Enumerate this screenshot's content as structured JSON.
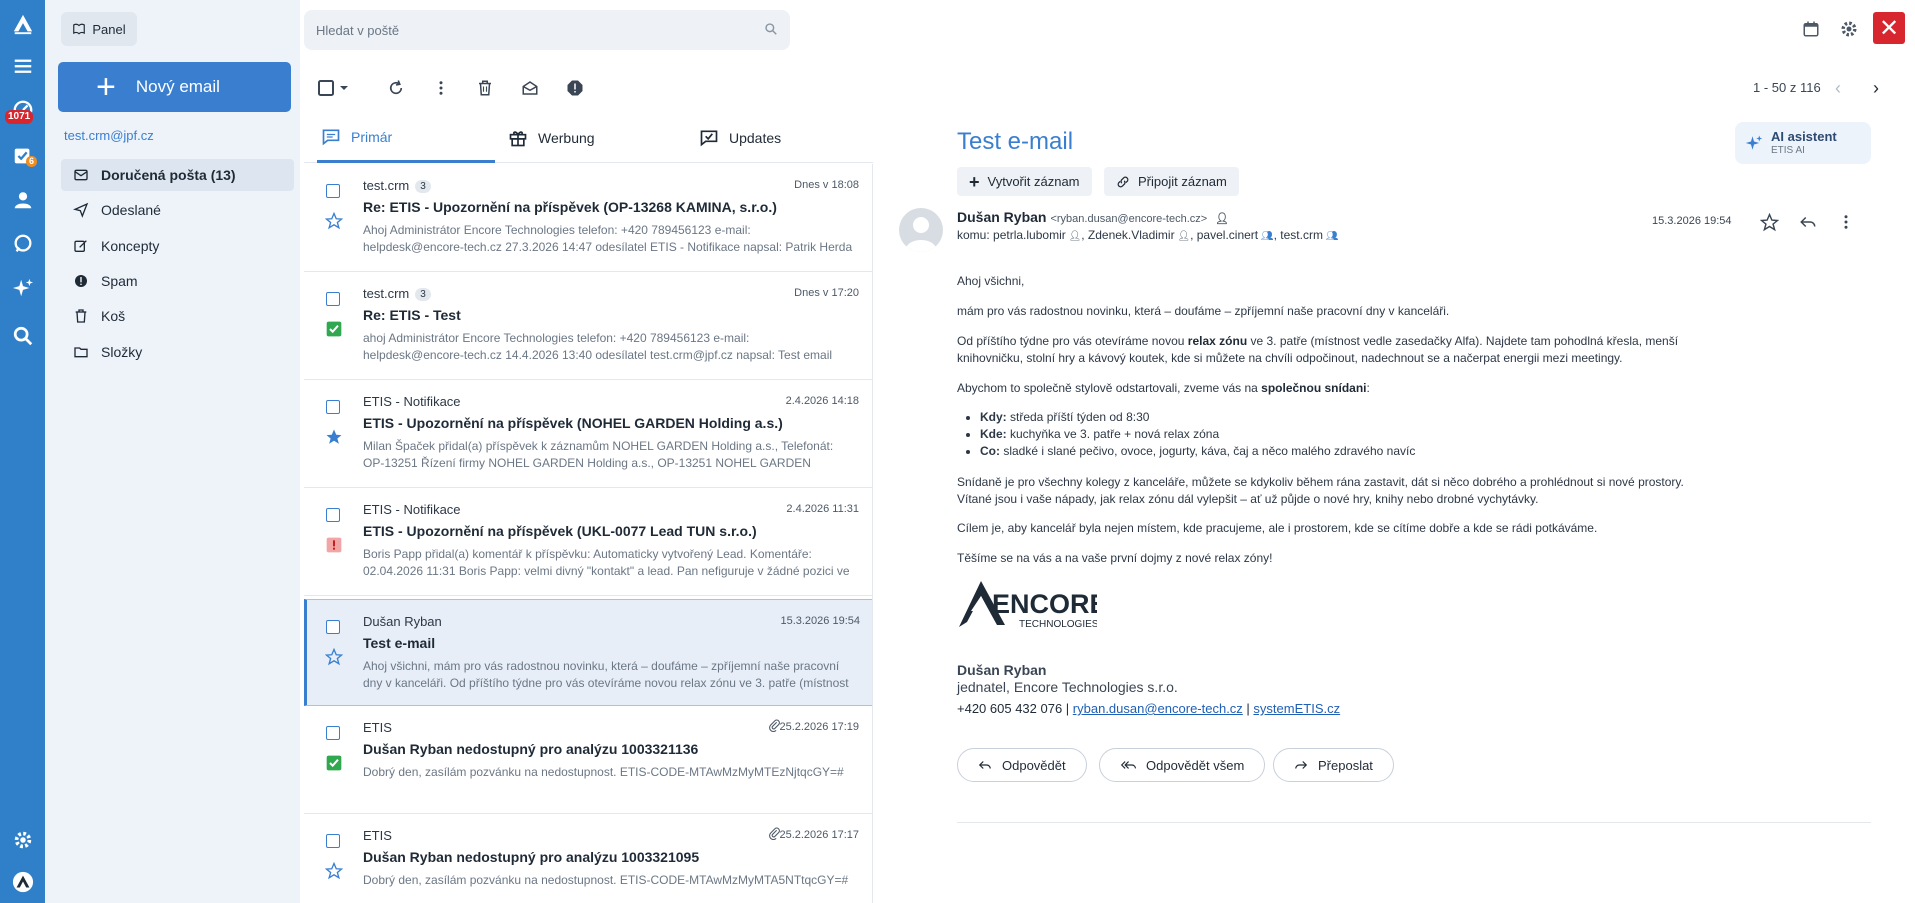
{
  "rail": {
    "badge_count": "1071",
    "task_badge": "6"
  },
  "sidebar": {
    "panel_label": "Panel",
    "new_email_label": "Nový email",
    "account": "test.crm@jpf.cz",
    "folders": [
      {
        "label": "Doručená pošta (13)",
        "icon": "inbox-icon"
      },
      {
        "label": "Odeslané",
        "icon": "send-icon"
      },
      {
        "label": "Koncepty",
        "icon": "draft-icon"
      },
      {
        "label": "Spam",
        "icon": "spam-icon"
      },
      {
        "label": "Koš",
        "icon": "trash-icon"
      },
      {
        "label": "Složky",
        "icon": "folder-icon"
      }
    ]
  },
  "search": {
    "placeholder": "Hledat v poště"
  },
  "toolbar": {
    "pager": "1 - 50 z 116"
  },
  "tabs": [
    {
      "label": "Primár"
    },
    {
      "label": "Werbung"
    },
    {
      "label": "Updates"
    }
  ],
  "messages": [
    {
      "from": "test.crm",
      "count": "3",
      "date": "Dnes v 18:08",
      "subject": "Re: ETIS - Upozornění na příspěvek (OP-13268 KAMINA, s.r.o.)",
      "preview": "Ahoj Administrátor Encore Technologies telefon: +420 789456123 e-mail: helpdesk@encore-tech.cz 27.3.2026 14:47 odesílatel ETIS - Notifikace napsal: Patrik Herda přidal(a) komentář k..."
    },
    {
      "from": "test.crm",
      "count": "3",
      "date": "Dnes v 17:20",
      "subject": "Re: ETIS - Test",
      "preview": "ahoj Administrátor Encore Technologies telefon: +420 789456123 e-mail: helpdesk@encore-tech.cz 14.4.2026 13:40 odesílatel test.crm@jpf.cz napsal: Test email"
    },
    {
      "from": "ETIS - Notifikace",
      "date": "2.4.2026 14:18",
      "subject": "ETIS - Upozornění na příspěvek (NOHEL GARDEN Holding a.s.)",
      "preview": "Milan Špaček přidal(a) příspěvek k záznamům NOHEL GARDEN Holding a.s., Telefonát: OP-13251 Řízení firmy NOHEL GARDEN Holding a.s., OP-13251 NOHEL GARDEN Holding a.s.: Nebere..."
    },
    {
      "from": "ETIS - Notifikace",
      "date": "2.4.2026 11:31",
      "subject": "ETIS - Upozornění na příspěvek (UKL-0077 Lead TUN s.r.o.)",
      "preview": "Boris Papp přidal(a) komentář k příspěvku: Automaticky vytvořený Lead. Komentáře: 02.04.2026 11:31 Boris Papp: velmi divný \"kontakt\" a lead. Pan nefiguruje v žádné pozici ve firmě, jen jako..."
    },
    {
      "from": "Dušan Ryban",
      "date": "15.3.2026 19:54",
      "subject": "Test e-mail",
      "preview": "Ahoj všichni, mám pro vás radostnou novinku, která – doufáme – zpříjemní naše pracovní dny v kanceláři. Od příštího týdne pro vás otevíráme novou relax zónu ve 3. patře (místnost vedle..."
    },
    {
      "from": "ETIS",
      "date": "25.2.2026 17:19",
      "subject": "Dušan Ryban nedostupný pro analýzu 1003321136",
      "preview": "Dobrý den, zasílám pozvánku na nedostupnost. ETIS-CODE-MTAwMzMyMTEzNjtqcGY=#"
    },
    {
      "from": "ETIS",
      "date": "25.2.2026 17:17",
      "subject": "Dušan Ryban nedostupný pro analýzu 1003321095",
      "preview": "Dobrý den, zasílám pozvánku na nedostupnost. ETIS-CODE-MTAwMzMyMTA5NTtqcGY=#"
    }
  ],
  "pane": {
    "title": "Test e-mail",
    "ai_label": "AI asistent",
    "ai_sub": "ETIS AI",
    "create_record": "Vytvořit záznam",
    "attach_record": "Připojit záznam",
    "sender_name": "Dušan Ryban",
    "sender_addr": "<ryban.dusan@encore-tech.cz>",
    "to_label": "komu:",
    "recipients": [
      "petrla.lubomir",
      "Zdenek.Vladimir",
      "pavel.cinert",
      "test.crm"
    ],
    "date": "15.3.2026 19:54",
    "greeting": "Ahoj všichni,",
    "p1": "mám pro vás radostnou novinku, která – doufáme – zpříjemní naše pracovní dny v kanceláři.",
    "p2a": "Od příštího týdne pro vás otevíráme novou ",
    "p2b": "relax zónu",
    "p2c": " ve 3. patře (místnost vedle zasedačky Alfa). Najdete tam pohodlná křesla, menší knihovničku, stolní hry a kávový koutek, kde si můžete na chvíli odpočinout, nadechnout se a načerpat energii mezi meetingy.",
    "p3a": "Abychom to společně stylově odstartovali, zveme vás na ",
    "p3b": "společnou snídani",
    "p3c": ":",
    "points": [
      {
        "k": "Kdy:",
        "v": " středa příští týden od 8:30"
      },
      {
        "k": "Kde:",
        "v": " kuchyňka ve 3. patře + nová relax zóna"
      },
      {
        "k": "Co:",
        "v": " sladké i slané pečivo, ovoce, jogurty, káva, čaj a něco malého zdravého navíc"
      }
    ],
    "p4": "Snídaně je pro všechny kolegy z kanceláře, můžete se kdykoliv během rána zastavit, dát si něco dobrého a prohlédnout si nové prostory. Vítané jsou i vaše nápady, jak relax zónu dál vylepšit – ať už půjde o nové hry, knihy nebo drobné vychytávky.",
    "p5": "Cílem je, aby kancelář byla nejen místem, kde pracujeme, ale i prostorem, kde se cítíme dobře a kde se rádi potkáváme.",
    "p6": "Těšíme se na vás a na vaše první dojmy z nové relax zóny!",
    "logo_text": "ENCORE",
    "logo_sub": "TECHNOLOGIES",
    "sig_name": "Dušan Ryban",
    "sig_role": "jednatel, Encore Technologies s.r.o.",
    "sig_phone": "+420 605 432 076 | ",
    "sig_email": "ryban.dusan@encore-tech.cz",
    "sig_sep": " | ",
    "sig_web": "systemETIS.cz",
    "reply": "Odpovědět",
    "reply_all": "Odpovědět všem",
    "forward": "Přeposlat"
  },
  "colors": {
    "accent": "#3a7fcf",
    "rail": "#2f80c9",
    "danger": "#d7262e",
    "flag_star": "#3a7fcf",
    "flag_green": "#2fa84f"
  }
}
